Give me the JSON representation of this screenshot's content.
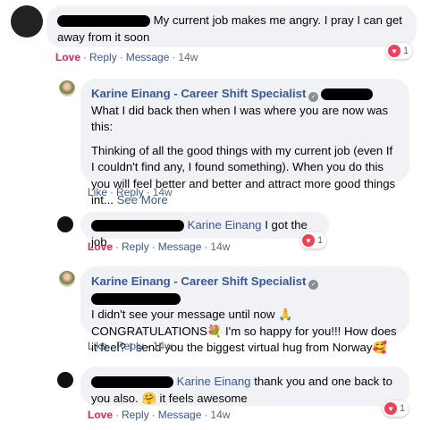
{
  "comments": [
    {
      "text": "My current job makes me angry. I pray I can get away from it soon",
      "actions": {
        "love": "Love",
        "reply": "Reply",
        "message": "Message",
        "time": "14w"
      },
      "reaction_count": "1"
    },
    {
      "author": "Karine Einang - Career Shift Specialist",
      "text_lead": "What I did back then when I was where you are now was this:",
      "text_body": "Thinking of all the good things with my current job (even If I couldn't find any, I found something). When you do this you will feel better and better and attract more good things int...",
      "see_more": "See More",
      "actions": {
        "like": "Like",
        "reply": "Reply",
        "time": "14w"
      }
    },
    {
      "tag": "Karine Einang",
      "text": "I got the job",
      "actions": {
        "love": "Love",
        "reply": "Reply",
        "message": "Message",
        "time": "14w"
      },
      "reaction_count": "1"
    },
    {
      "author": "Karine Einang - Career Shift Specialist",
      "text_a": "I didn't see your message until now 🙏",
      "text_b": "CONGRATULATIONS💐 I'm so happy for you!!! How does it feel? I send you the biggest virtual hug from Norway🥰",
      "actions": {
        "like": "Like",
        "reply": "Reply",
        "time": "14w"
      }
    },
    {
      "tag": "Karine Einang",
      "text": "thank you and one back to you also. 🤗 it feels awesome",
      "actions": {
        "love": "Love",
        "reply": "Reply",
        "message": "Message",
        "time": "14w"
      },
      "reaction_count": "1"
    }
  ],
  "colors": {
    "link": "#385898",
    "love": "#e0245e",
    "bubble": "#f0f2f5",
    "meta": "#606770"
  },
  "icons": [
    "heart-icon",
    "verified-badge-icon"
  ]
}
